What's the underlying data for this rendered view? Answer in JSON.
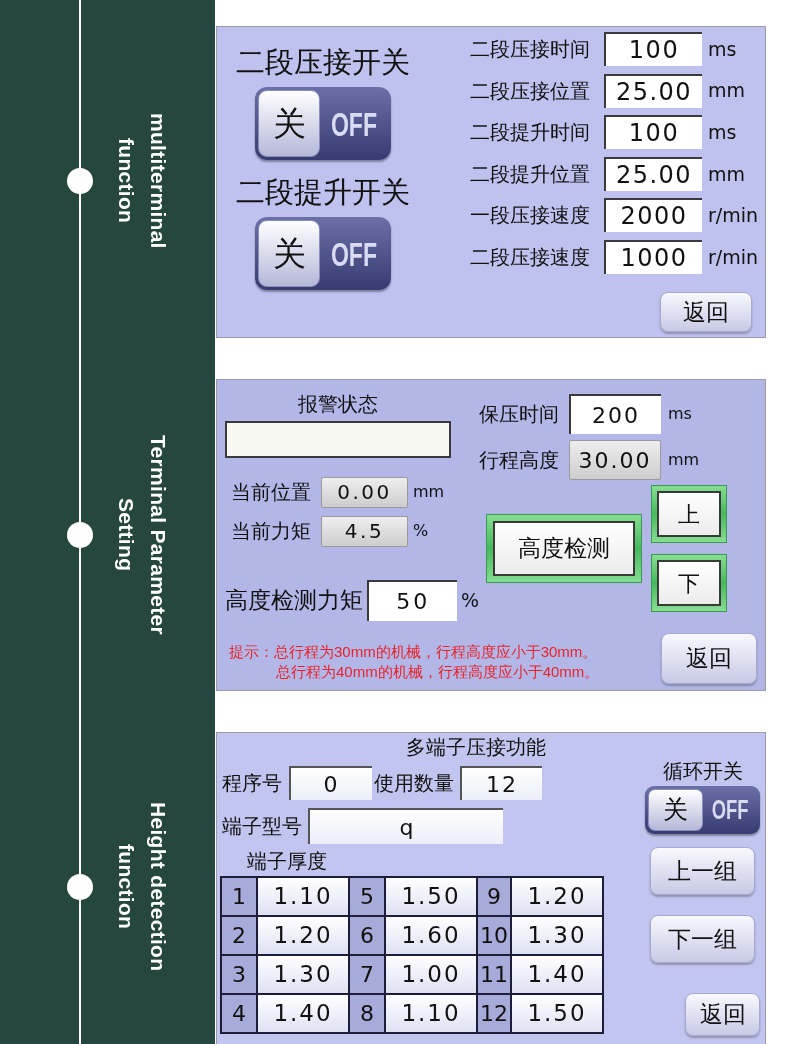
{
  "sidebar": {
    "steps": [
      {
        "label": "multiterminal\nfunction"
      },
      {
        "label": "Terminal Parameter\nSetting"
      },
      {
        "label": "Height detection\nfunction"
      }
    ]
  },
  "crimp_panel": {
    "switches": [
      {
        "label": "二段压接开关",
        "knob_text": "关",
        "state_text": "OFF",
        "on": false
      },
      {
        "label": "二段提升开关",
        "knob_text": "关",
        "state_text": "OFF",
        "on": false
      }
    ],
    "settings": [
      {
        "label": "二段压接时间",
        "value": "100",
        "unit": "ms"
      },
      {
        "label": "二段压接位置",
        "value": "25.00",
        "unit": "mm"
      },
      {
        "label": "二段提升时间",
        "value": "100",
        "unit": "ms"
      },
      {
        "label": "二段提升位置",
        "value": "25.00",
        "unit": "mm"
      },
      {
        "label": "一段压接速度",
        "value": "2000",
        "unit": "r/min"
      },
      {
        "label": "二段压接速度",
        "value": "1000",
        "unit": "r/min"
      }
    ],
    "return_button": "返回"
  },
  "height_panel": {
    "alarm": {
      "label": "报警状态"
    },
    "readouts": [
      {
        "label": "当前位置",
        "value": "0.00",
        "unit": "mm",
        "kind": "display"
      },
      {
        "label": "当前力矩",
        "value": "4.5",
        "unit": "%",
        "kind": "display"
      }
    ],
    "detect_torque": {
      "label": "高度检测力矩",
      "value": "50",
      "unit": "%",
      "kind": "input"
    },
    "parameters": [
      {
        "label": "保压时间",
        "value": "200",
        "unit": "ms",
        "kind": "input"
      },
      {
        "label": "行程高度",
        "value": "30.00",
        "unit": "mm",
        "kind": "display"
      }
    ],
    "detect_button": "高度检测",
    "up_button": "上",
    "down_button": "下",
    "hint_lines": [
      "提示：总行程为30mm的机械，行程高度应小于30mm。",
      "总行程为40mm的机械，行程高度应小于40mm。"
    ],
    "return_button": "返回"
  },
  "multi_panel": {
    "title": "多端子压接功能",
    "program": {
      "label": "程序号",
      "value": "0"
    },
    "count": {
      "label": "使用数量",
      "value": "12"
    },
    "model": {
      "label": "端子型号",
      "value": "q"
    },
    "thickness_label": "端子厚度",
    "thickness": [
      {
        "index": "1",
        "value": "1.10"
      },
      {
        "index": "2",
        "value": "1.20"
      },
      {
        "index": "3",
        "value": "1.30"
      },
      {
        "index": "4",
        "value": "1.40"
      },
      {
        "index": "5",
        "value": "1.50"
      },
      {
        "index": "6",
        "value": "1.60"
      },
      {
        "index": "7",
        "value": "1.00"
      },
      {
        "index": "8",
        "value": "1.10"
      },
      {
        "index": "9",
        "value": "1.20"
      },
      {
        "index": "10",
        "value": "1.30"
      },
      {
        "index": "11",
        "value": "1.40"
      },
      {
        "index": "12",
        "value": "1.50"
      }
    ],
    "loop_switch": {
      "label": "循环开关",
      "knob_text": "关",
      "state_text": "OFF",
      "on": false
    },
    "prev_button": "上一组",
    "next_button": "下一组",
    "return_button": "返回"
  }
}
